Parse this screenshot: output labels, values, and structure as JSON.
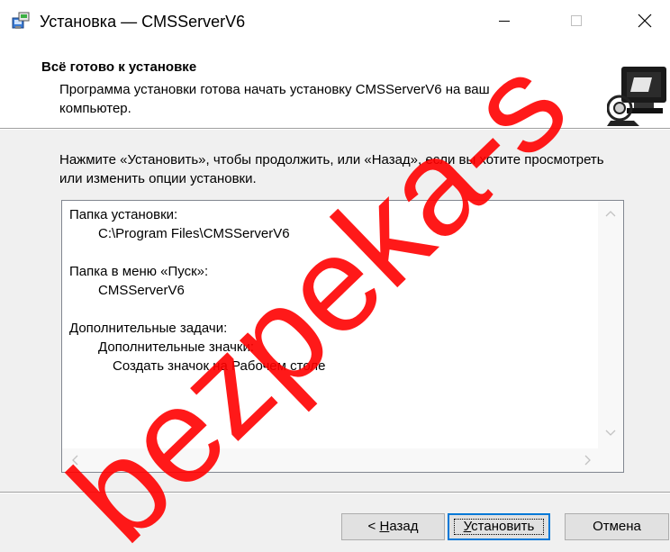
{
  "window": {
    "title": "Установка — CMSServerV6"
  },
  "header": {
    "title": "Всё готово к установке",
    "subtitle": "Программа установки готова начать установку CMSServerV6 на ваш компьютер."
  },
  "body": {
    "instruction": "Нажмите «Установить», чтобы продолжить, или «Назад», если вы хотите просмотреть или изменить опции установки."
  },
  "summary": {
    "lines": [
      {
        "text": "Папка установки:",
        "level": 0
      },
      {
        "text": "C:\\Program Files\\CMSServerV6",
        "level": 1
      },
      {
        "text": "",
        "level": 0
      },
      {
        "text": "Папка в меню «Пуск»:",
        "level": 0
      },
      {
        "text": "CMSServerV6",
        "level": 1
      },
      {
        "text": "",
        "level": 0
      },
      {
        "text": "Дополнительные задачи:",
        "level": 0
      },
      {
        "text": "Дополнительные значки:",
        "level": 1
      },
      {
        "text": "Создать значок на Рабочем столе",
        "level": 2
      }
    ]
  },
  "buttons": {
    "back": "< Назад",
    "install": "Установить",
    "cancel": "Отмена"
  },
  "icons": {
    "app": "installer-icon",
    "header": "computer-setup-icon"
  },
  "watermark": "bezpeka-s",
  "colors": {
    "accent": "#0078d7",
    "watermark": "#ff0000"
  }
}
